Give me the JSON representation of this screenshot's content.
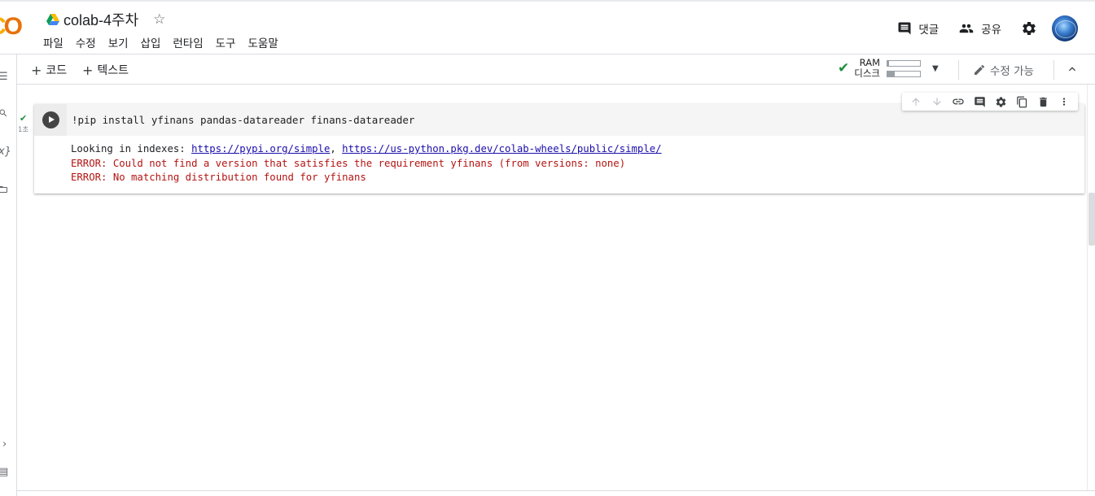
{
  "app": {
    "logo_text_1": "C",
    "logo_text_2": "O",
    "title": "colab-4주차",
    "star_icon": "star-outline-icon"
  },
  "menu": [
    "파일",
    "수정",
    "보기",
    "삽입",
    "런타임",
    "도구",
    "도움말"
  ],
  "header_right": {
    "comment_label": "댓글",
    "share_label": "공유"
  },
  "toolbar": {
    "add_code": "코드",
    "add_text": "텍스트",
    "ram_label": "RAM",
    "disk_label": "디스크",
    "ram_usage": 0.04,
    "disk_usage": 0.22,
    "edit_label": "수정 가능"
  },
  "cell": {
    "status_time": "1초",
    "code": "!pip install yfinans pandas-datareader finans-datareader",
    "output": {
      "line1_prefix": "Looking in indexes: ",
      "link1": "https://pypi.org/simple",
      "sep": ", ",
      "link2": "https://us-python.pkg.dev/colab-wheels/public/simple/",
      "error1": "ERROR: Could not find a version that satisfies the requirement yfinans (from versions: none)",
      "error2": "ERROR: No matching distribution found for yfinans"
    }
  },
  "colors": {
    "accent_green": "#1e8e3e",
    "error_red": "#b31412",
    "link": "#1a0dab",
    "logo_yellow": "#f9ab00",
    "logo_orange": "#e8710a"
  }
}
